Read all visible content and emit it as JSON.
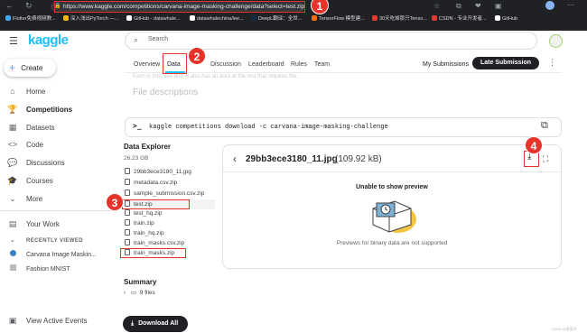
{
  "browser": {
    "url": "https://www.kaggle.com/competitions/carvana-image-masking-challenge/data?select=test.zip",
    "bookmarks": [
      "Flutter免费视频教...",
      "深入浅出PyTorch —...",
      "GitHub - datawhale...",
      "datawhalechina/lee...",
      "DeepL翻译：全世...",
      "TensorFlow 模型建...",
      "30天吃掉那只Tenso...",
      "CSDN - 专业开发者...",
      "GitHub"
    ]
  },
  "sidebar": {
    "logo": "kaggle",
    "create": "Create",
    "items": [
      "Home",
      "Competitions",
      "Datasets",
      "Code",
      "Discussions",
      "Courses",
      "More"
    ],
    "your_work": "Your Work",
    "recently_viewed_heading": "RECENTLY VIEWED",
    "recent": [
      "Carvana Image Maskin...",
      "Fashion MNIST"
    ],
    "view_events": "View Active Events"
  },
  "search": {
    "placeholder": "Search"
  },
  "tabs": [
    "Overview",
    "Data",
    "Discussion",
    "Leaderboard",
    "Rules",
    "Team"
  ],
  "my_submissions": "My Submissions",
  "late_submission": "Late Submission",
  "faded_text": "Each in this, see test. It also has an area at the rest that requires the...",
  "file_descriptions": "File descriptions",
  "command": "kaggle competitions download -c carvana-image-masking-challenge",
  "data_explorer": {
    "title": "Data Explorer",
    "size": "26.23 GB",
    "files": [
      "29bb3ece3180_11.jpg",
      "metadata.csv.zip",
      "sample_submission.csv.zip",
      "test.zip",
      "test_hq.zip",
      "train.zip",
      "train_hq.zip",
      "train_masks.csv.zip",
      "train_masks.zip"
    ]
  },
  "preview": {
    "filename": "29bb3ece3180_11.jpg",
    "size": "(109.92 kB)",
    "unable": "Unable to show preview",
    "unsupported": "Previews for binary data are not supported"
  },
  "summary": {
    "title": "Summary",
    "files": "9 files"
  },
  "download_all": "Download All",
  "annotations": [
    "1",
    "2",
    "3",
    "4"
  ],
  "watermark": "CSDN @老菜鸟"
}
